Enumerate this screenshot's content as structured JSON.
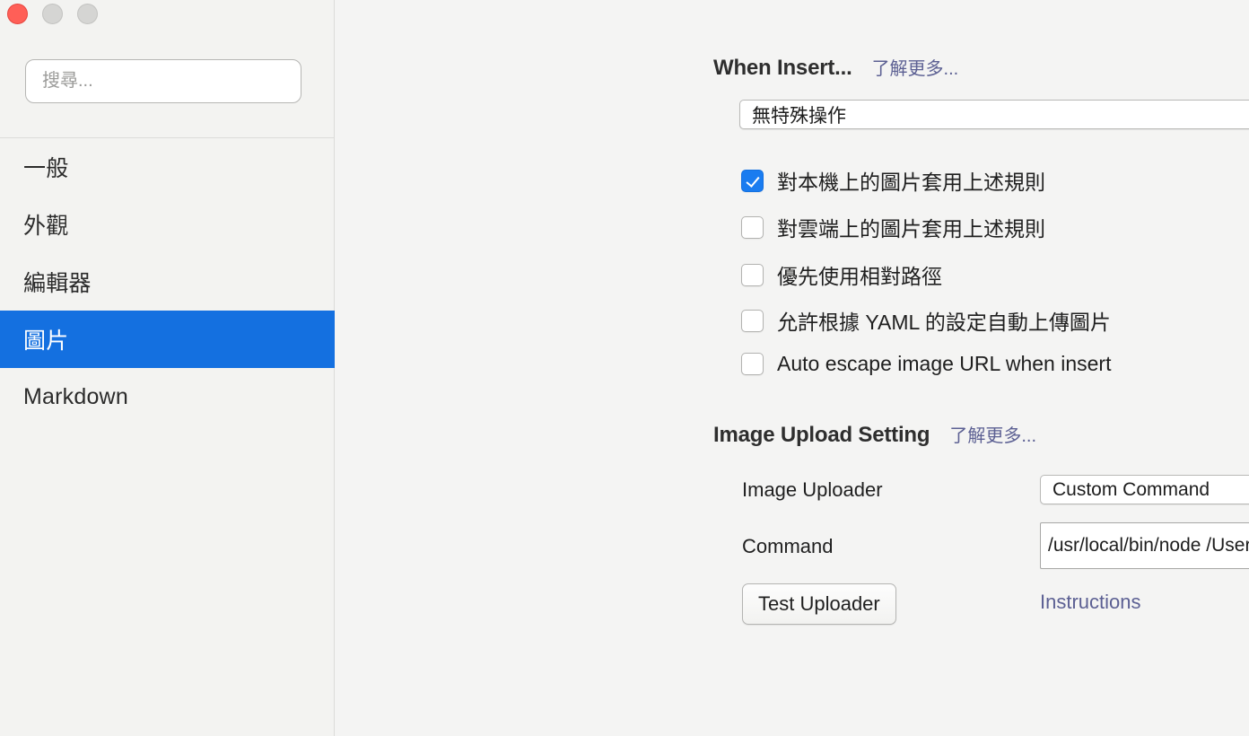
{
  "window": {
    "traffic_lights": {
      "close_label": "close",
      "minimize_label": "minimize",
      "maximize_label": "maximize"
    }
  },
  "sidebar": {
    "search": {
      "placeholder": "搜尋...",
      "value": ""
    },
    "items": [
      {
        "label": "一般",
        "selected": false
      },
      {
        "label": "外觀",
        "selected": false
      },
      {
        "label": "編輯器",
        "selected": false
      },
      {
        "label": "圖片",
        "selected": true
      },
      {
        "label": "Markdown",
        "selected": false
      }
    ]
  },
  "main": {
    "when_insert": {
      "title": "When Insert...",
      "learn_more": "了解更多...",
      "action_select": {
        "value": "無特殊操作"
      },
      "checkboxes": [
        {
          "label": "對本機上的圖片套用上述規則",
          "checked": true
        },
        {
          "label": "對雲端上的圖片套用上述規則",
          "checked": false
        },
        {
          "label": "優先使用相對路徑",
          "checked": false
        },
        {
          "label": "允許根據 YAML 的設定自動上傳圖片",
          "checked": false
        },
        {
          "label": "Auto escape image URL when insert",
          "checked": false
        }
      ],
      "help_glyph": "?"
    },
    "image_upload": {
      "title": "Image Upload Setting",
      "learn_more": "了解更多...",
      "uploader_label": "Image Uploader",
      "uploader_value": "Custom Command",
      "command_label": "Command",
      "command_value": "/usr/local/bin/node /Users/lisa/node_modules",
      "test_button": "Test Uploader",
      "instructions_link": "Instructions"
    }
  },
  "colors": {
    "selection_blue": "#1470e0",
    "checkbox_blue": "#1a7cf0",
    "link_slate": "#5c6093",
    "window_bg": "#f4f4f3",
    "sidebar_bg": "#f3f3f1",
    "close_red": "#ff5f57"
  }
}
